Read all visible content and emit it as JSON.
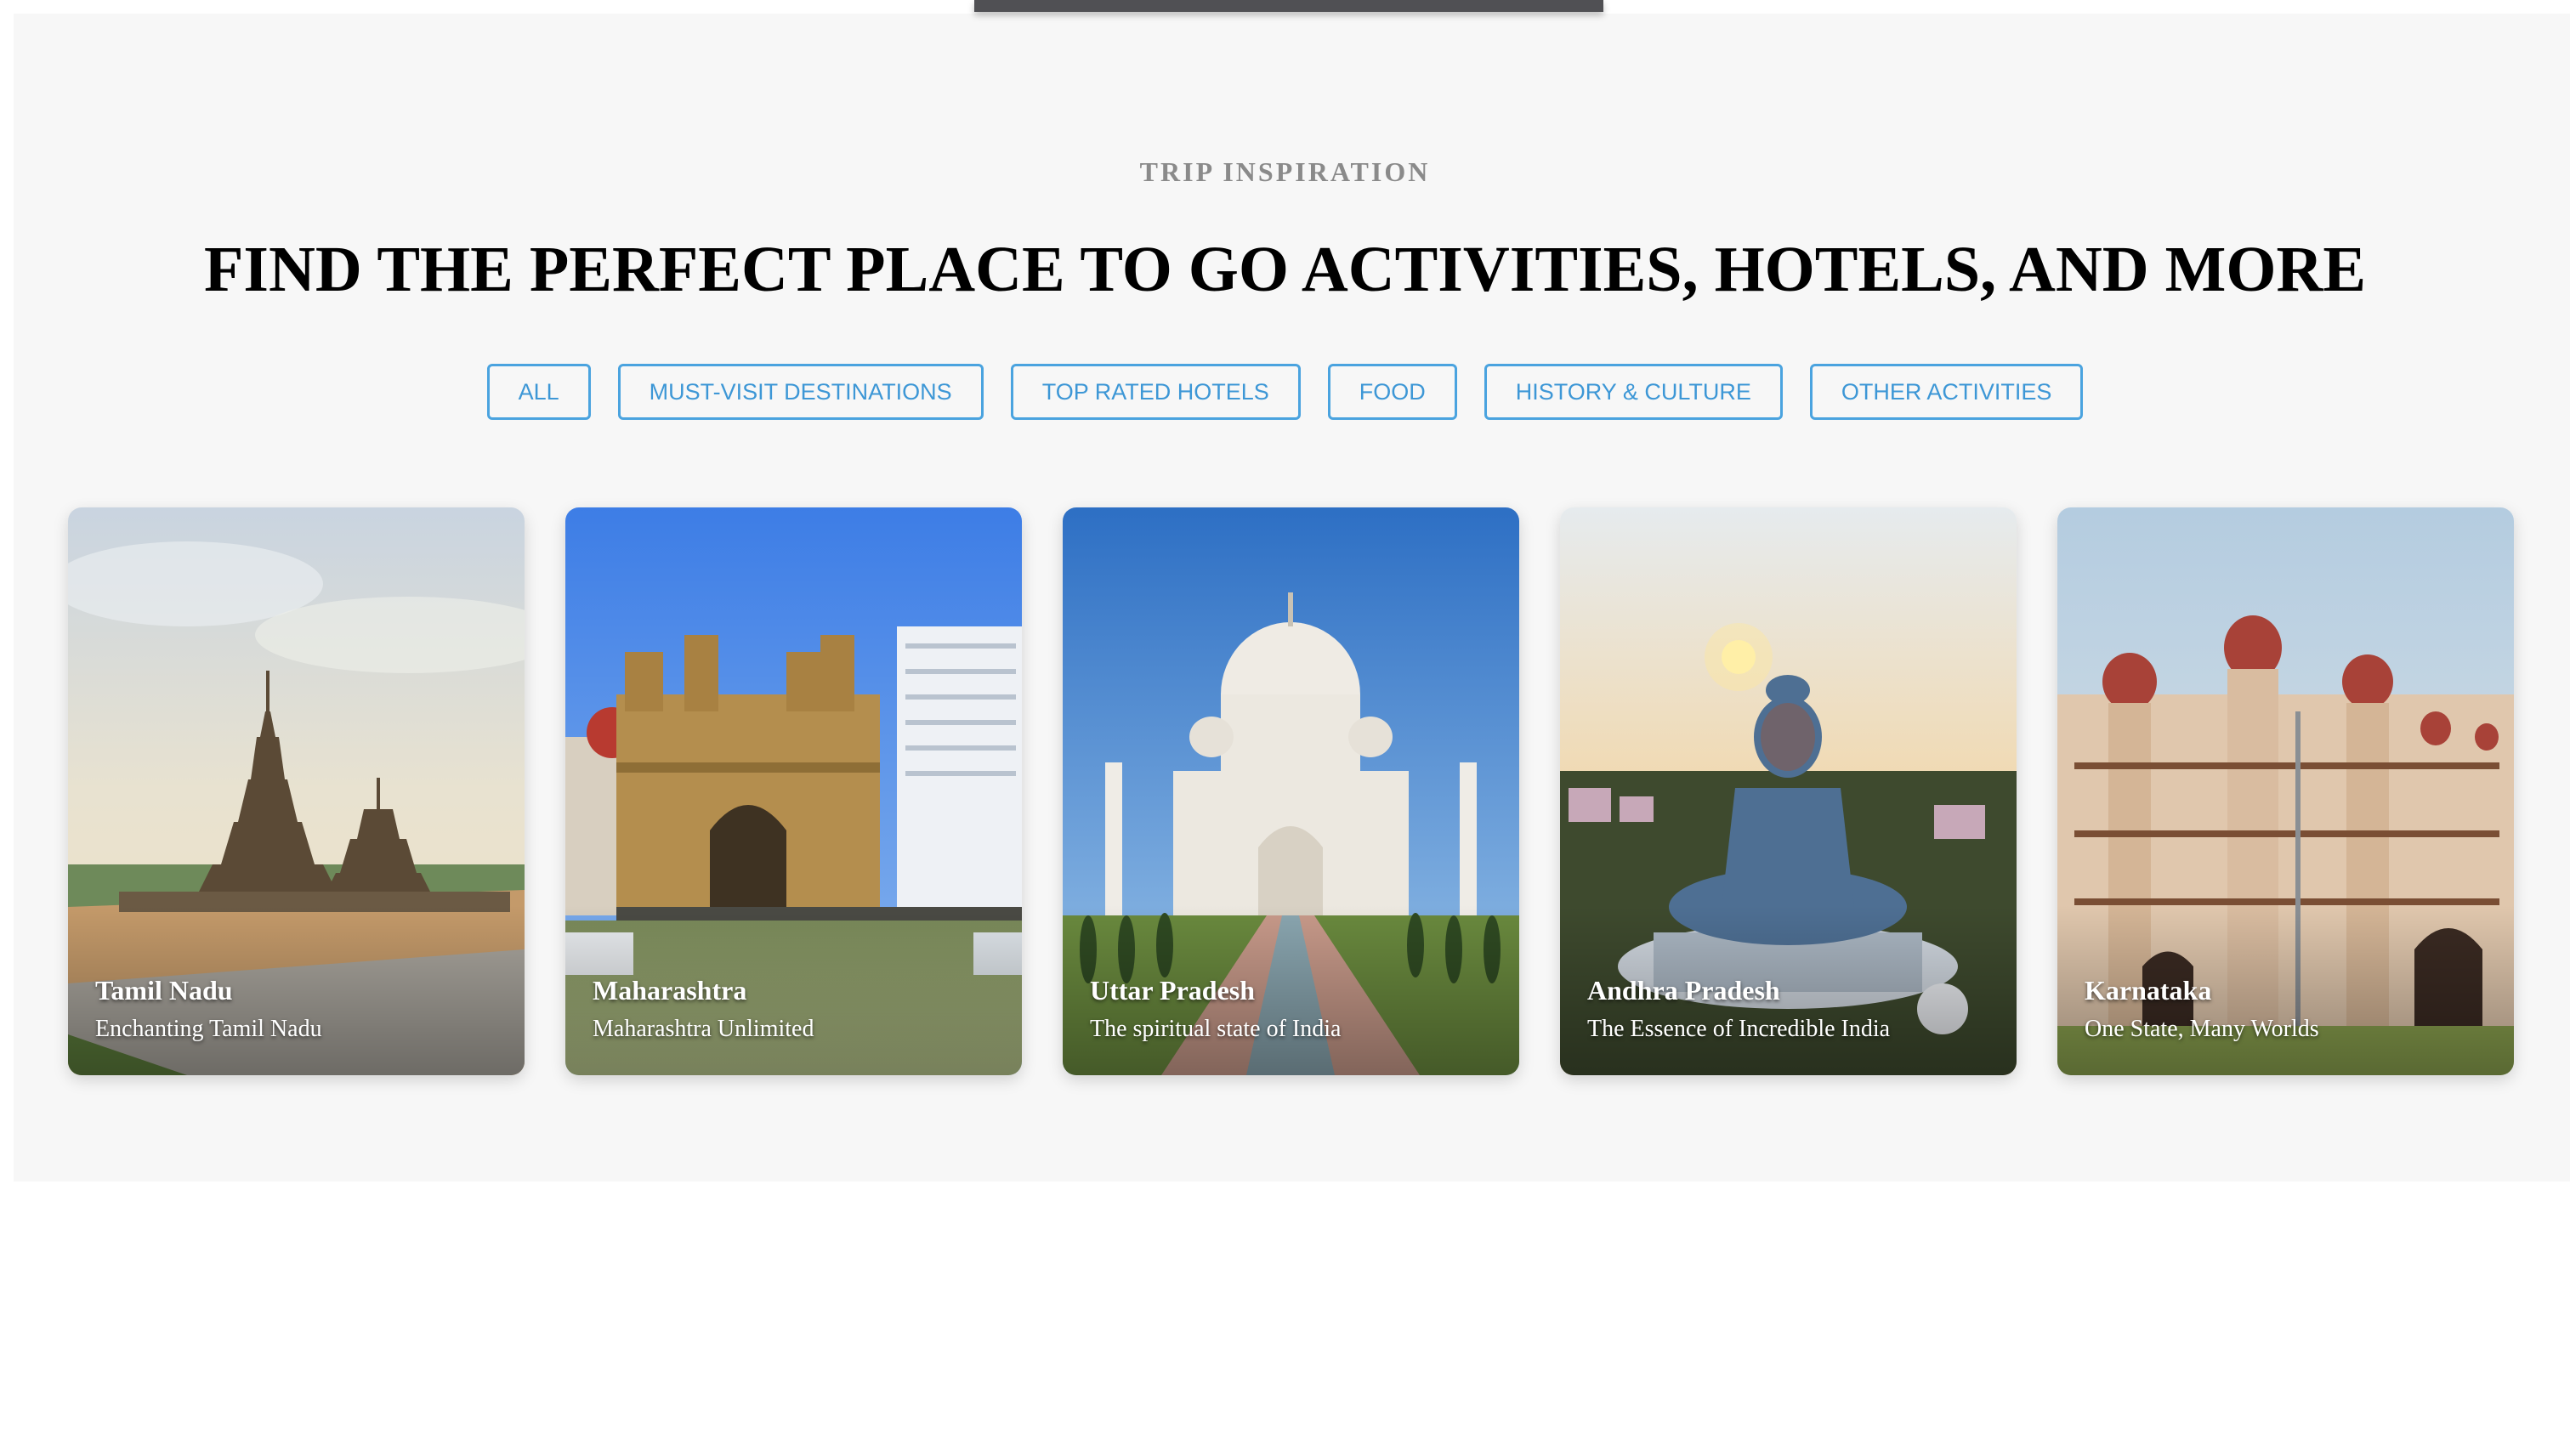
{
  "section": {
    "eyebrow": "TRIP INSPIRATION",
    "headline": "FIND THE PERFECT PLACE TO GO ACTIVITIES, HOTELS, AND MORE"
  },
  "filters": [
    {
      "label": "ALL"
    },
    {
      "label": "MUST-VISIT DESTINATIONS"
    },
    {
      "label": "TOP RATED HOTELS"
    },
    {
      "label": "FOOD"
    },
    {
      "label": "HISTORY & CULTURE"
    },
    {
      "label": "OTHER ACTIVITIES"
    }
  ],
  "cards": [
    {
      "title": "Tamil Nadu",
      "subtitle": "Enchanting Tamil Nadu",
      "image": "shore-temple-photo"
    },
    {
      "title": "Maharashtra",
      "subtitle": "Maharashtra Unlimited",
      "image": "gateway-of-india-photo"
    },
    {
      "title": "Uttar Pradesh",
      "subtitle": "The spiritual state of India",
      "image": "taj-mahal-photo"
    },
    {
      "title": "Andhra Pradesh",
      "subtitle": "The Essence of Incredible India",
      "image": "buddha-statue-photo"
    },
    {
      "title": "Karnataka",
      "subtitle": "One State, Many Worlds",
      "image": "mysore-palace-photo"
    }
  ],
  "colors": {
    "accent": "#3d97d6",
    "section_bg": "#f7f7f7",
    "eyebrow": "#8a8a8a"
  }
}
